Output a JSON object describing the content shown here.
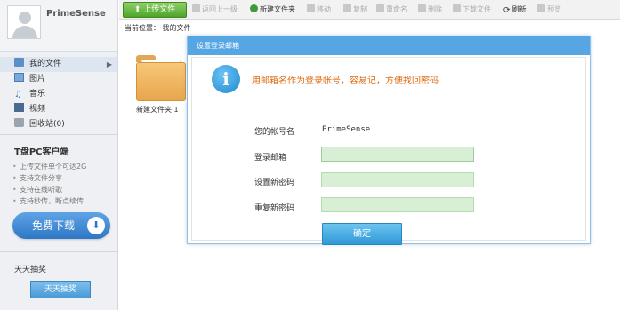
{
  "profile": {
    "username": "PrimeSense"
  },
  "sidebar": {
    "items": [
      {
        "label": "我的文件",
        "icon": "folder-icon",
        "active": true
      },
      {
        "label": "图片",
        "icon": "image-icon"
      },
      {
        "label": "音乐",
        "icon": "music-icon"
      },
      {
        "label": "视频",
        "icon": "video-icon"
      },
      {
        "label": "回收站(0)",
        "icon": "trash-icon"
      }
    ],
    "client": {
      "title": "T盘PC客户端",
      "features": [
        "上传文件单个可达2G",
        "支持文件分享",
        "支持在线听歌",
        "支持秒传，断点续传"
      ],
      "download_label": "免费下载"
    },
    "lottery": {
      "title": "天天抽奖",
      "button_label": "天天抽奖"
    }
  },
  "toolbar": {
    "upload": "上传文件",
    "up_level": "返回上一级",
    "new_folder": "新建文件夹",
    "move": "移动",
    "copy": "复制",
    "rename": "重命名",
    "delete": "删除",
    "download": "下载文件",
    "refresh": "刷新",
    "preview": "预览"
  },
  "breadcrumb": {
    "prefix": "当前位置：",
    "current": "我的文件"
  },
  "files": [
    {
      "name": "新建文件夹 1"
    }
  ],
  "dialog": {
    "title": "设置登录邮箱",
    "message": "用邮箱名作为登录帐号，容易记，方便找回密码",
    "account_label": "您的帐号名",
    "account_value": "PrimeSense",
    "email_label": "登录邮箱",
    "email_value": "",
    "new_password_label": "设置新密码",
    "repeat_password_label": "重复新密码",
    "confirm_label": "确定"
  },
  "colors": {
    "accent": "#55a6e3",
    "upload_button": "#4ea52a",
    "info_text": "#e06a10",
    "input_bg": "#d8efd6"
  }
}
